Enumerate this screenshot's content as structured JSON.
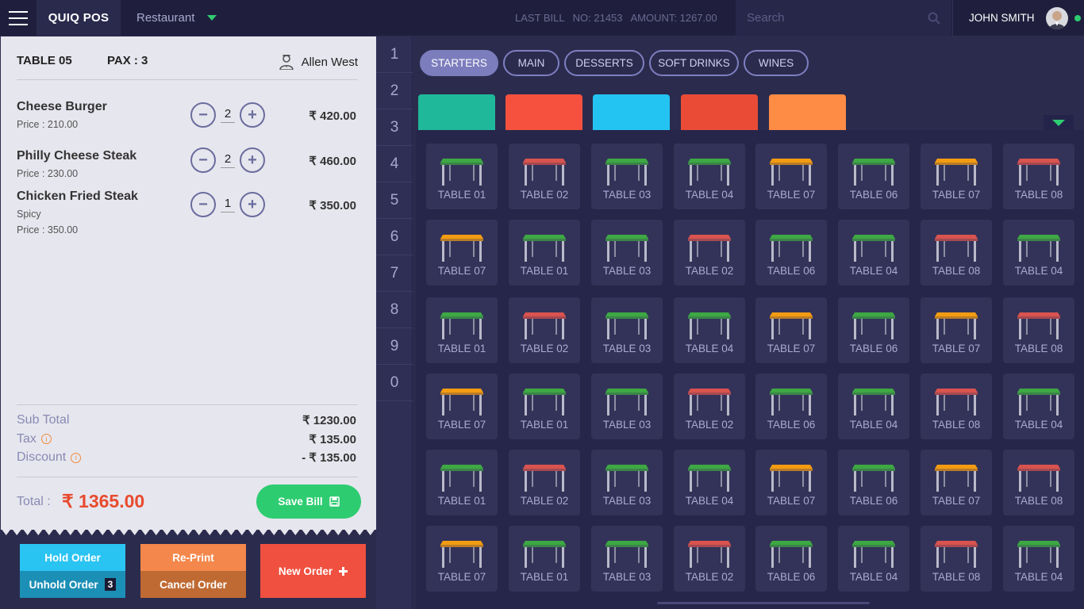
{
  "topbar": {
    "brand": "QUIQ POS",
    "venue": "Restaurant",
    "last_bill_label": "LAST BILL",
    "last_bill_no": "NO: 21453",
    "last_bill_amount": "AMOUNT: 1267.00",
    "search_placeholder": "Search",
    "user_name": "JOHN SMITH"
  },
  "order": {
    "table": "TABLE 05",
    "pax": "PAX : 3",
    "waiter": "Allen West",
    "items": [
      {
        "name": "Cheese Burger",
        "note": "",
        "price": "Price  : 210.00",
        "qty": "2",
        "amount": "₹ 420.00"
      },
      {
        "name": "Philly Cheese Steak",
        "note": "",
        "price": "Price  : 230.00",
        "qty": "2",
        "amount": "₹ 460.00"
      },
      {
        "name": "Chicken Fried Steak",
        "note": "Spicy",
        "price": "Price  : 350.00",
        "qty": "1",
        "amount": "₹ 350.00"
      }
    ],
    "sub_total_label": "Sub Total",
    "sub_total": "₹ 1230.00",
    "tax_label": "Tax",
    "tax": "₹ 135.00",
    "discount_label": "Discount",
    "discount": "- ₹ 135.00",
    "total_label": "Total  :",
    "total": "₹ 1365.00",
    "save_label": "Save Bill"
  },
  "actions": {
    "hold": "Hold Order",
    "unhold": "Unhold Order",
    "unhold_count": "3",
    "reprint": "Re-Print",
    "cancel": "Cancel Order",
    "new_order": "New Order"
  },
  "numpad": [
    "1",
    "2",
    "3",
    "4",
    "5",
    "6",
    "7",
    "8",
    "9",
    "0"
  ],
  "categories": [
    {
      "label": "STARTERS",
      "active": true
    },
    {
      "label": "MAIN",
      "active": false
    },
    {
      "label": "DESSERTS",
      "active": false
    },
    {
      "label": "SOFT DRINKS",
      "active": false
    },
    {
      "label": "WINES",
      "active": false
    }
  ],
  "floor_colors": [
    "#1fb89a",
    "#f5513e",
    "#24c4f2",
    "#e94b37",
    "#ff8c45"
  ],
  "status_colors": {
    "green": "#3ea843",
    "red": "#d9534f",
    "orange": "#f39c12"
  },
  "tables": [
    [
      {
        "label": "TABLE 01",
        "status": "green"
      },
      {
        "label": "TABLE 02",
        "status": "red"
      },
      {
        "label": "TABLE 03",
        "status": "green"
      },
      {
        "label": "TABLE 04",
        "status": "green"
      },
      {
        "label": "TABLE 07",
        "status": "orange"
      },
      {
        "label": "TABLE 06",
        "status": "green"
      },
      {
        "label": "TABLE 07",
        "status": "orange"
      },
      {
        "label": "TABLE 08",
        "status": "red"
      }
    ],
    [
      {
        "label": "TABLE 07",
        "status": "orange"
      },
      {
        "label": "TABLE 01",
        "status": "green"
      },
      {
        "label": "TABLE 03",
        "status": "green"
      },
      {
        "label": "TABLE 02",
        "status": "red"
      },
      {
        "label": "TABLE 06",
        "status": "green"
      },
      {
        "label": "TABLE 04",
        "status": "green"
      },
      {
        "label": "TABLE 08",
        "status": "red"
      },
      {
        "label": "TABLE 04",
        "status": "green"
      }
    ],
    [
      {
        "label": "TABLE 01",
        "status": "green"
      },
      {
        "label": "TABLE 02",
        "status": "red"
      },
      {
        "label": "TABLE 03",
        "status": "green"
      },
      {
        "label": "TABLE 04",
        "status": "green"
      },
      {
        "label": "TABLE 07",
        "status": "orange"
      },
      {
        "label": "TABLE 06",
        "status": "green"
      },
      {
        "label": "TABLE 07",
        "status": "orange"
      },
      {
        "label": "TABLE 08",
        "status": "red"
      }
    ],
    [
      {
        "label": "TABLE 07",
        "status": "orange"
      },
      {
        "label": "TABLE 01",
        "status": "green"
      },
      {
        "label": "TABLE 03",
        "status": "green"
      },
      {
        "label": "TABLE 02",
        "status": "red"
      },
      {
        "label": "TABLE 06",
        "status": "green"
      },
      {
        "label": "TABLE 04",
        "status": "green"
      },
      {
        "label": "TABLE 08",
        "status": "red"
      },
      {
        "label": "TABLE 04",
        "status": "green"
      }
    ],
    [
      {
        "label": "TABLE 01",
        "status": "green"
      },
      {
        "label": "TABLE 02",
        "status": "red"
      },
      {
        "label": "TABLE 03",
        "status": "green"
      },
      {
        "label": "TABLE 04",
        "status": "green"
      },
      {
        "label": "TABLE 07",
        "status": "orange"
      },
      {
        "label": "TABLE 06",
        "status": "green"
      },
      {
        "label": "TABLE 07",
        "status": "orange"
      },
      {
        "label": "TABLE 08",
        "status": "red"
      }
    ],
    [
      {
        "label": "TABLE 07",
        "status": "orange"
      },
      {
        "label": "TABLE 01",
        "status": "green"
      },
      {
        "label": "TABLE 03",
        "status": "green"
      },
      {
        "label": "TABLE 02",
        "status": "red"
      },
      {
        "label": "TABLE 06",
        "status": "green"
      },
      {
        "label": "TABLE 04",
        "status": "green"
      },
      {
        "label": "TABLE 08",
        "status": "red"
      },
      {
        "label": "TABLE 04",
        "status": "green"
      }
    ]
  ]
}
